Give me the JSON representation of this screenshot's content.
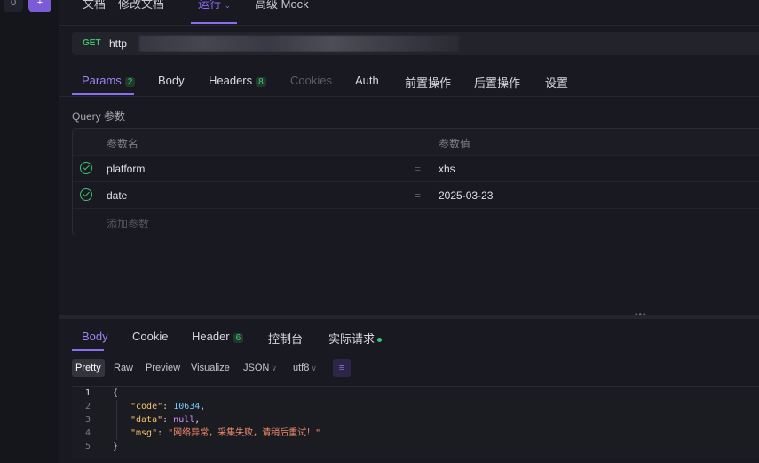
{
  "top_tabs": [
    "文档",
    "修改文档",
    "运行",
    "高级 Mock"
  ],
  "top_tabs_active": "运行",
  "request": {
    "method": "GET",
    "url_prefix": "http"
  },
  "req_tabs": {
    "params": "Params",
    "params_count": "2",
    "body": "Body",
    "headers": "Headers",
    "headers_count": "8",
    "cookies": "Cookies",
    "auth": "Auth",
    "pre": "前置操作",
    "post": "后置操作",
    "settings": "设置"
  },
  "query": {
    "label": "Query 参数",
    "header_name": "参数名",
    "header_value": "参数值",
    "params": [
      {
        "name": "platform",
        "value": "xhs"
      },
      {
        "name": "date",
        "value": "2025-03-23"
      }
    ],
    "add_label": "添加参数",
    "eq": "="
  },
  "resp_tabs": {
    "body": "Body",
    "cookie": "Cookie",
    "header": "Header",
    "header_count": "6",
    "console": "控制台",
    "actual": "实际请求"
  },
  "format": {
    "pretty": "Pretty",
    "raw": "Raw",
    "preview": "Preview",
    "visualize": "Visualize",
    "lang": "JSON",
    "encoding": "utf8",
    "wrap_icon": "wrap-lines-icon"
  },
  "response_lines": [
    {
      "n": "1"
    },
    {
      "n": "2",
      "key": "\"code\"",
      "value": "10634"
    },
    {
      "n": "3",
      "key": "\"data\"",
      "value": "null"
    },
    {
      "n": "4",
      "key": "\"msg\"",
      "value": "\"网络异常，采集失败，请稍后重试！\""
    },
    {
      "n": "5"
    }
  ],
  "colors": {
    "accent": "#8b6df0",
    "success": "#3fbf78",
    "method_get": "#39c46f"
  }
}
